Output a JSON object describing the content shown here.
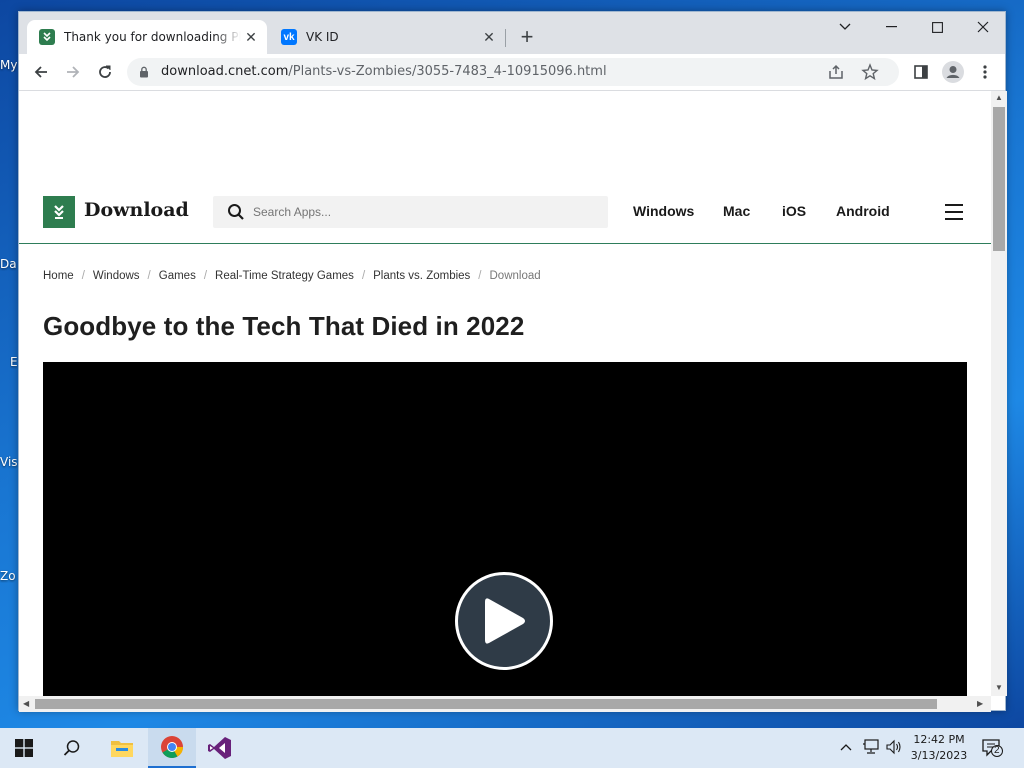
{
  "desktop": {
    "icon_labels": [
      "My",
      "Da",
      "E",
      "Vis",
      "Zo"
    ]
  },
  "browser": {
    "tabs": [
      {
        "title": "Thank you for downloading Plants vs. Zombies",
        "favicon": "download-favicon",
        "active": true
      },
      {
        "title": "VK ID",
        "favicon": "vk-favicon",
        "active": false
      }
    ],
    "url_host": "download.cnet.com",
    "url_path": "/Plants-vs-Zombies/3055-7483_4-10915096.html"
  },
  "site": {
    "logo_text": "Download",
    "search_placeholder": "Search Apps...",
    "nav": [
      "Windows",
      "Mac",
      "iOS",
      "Android"
    ],
    "breadcrumb": [
      "Home",
      "Windows",
      "Games",
      "Real-Time Strategy Games",
      "Plants vs. Zombies",
      "Download"
    ],
    "article_title": "Goodbye to the Tech That Died in 2022"
  },
  "taskbar": {
    "time": "12:42 PM",
    "date": "3/13/2023",
    "notification_count": "2"
  },
  "colors": {
    "brand_green": "#2e7d4f",
    "vk_blue": "#0077ff",
    "taskbar_bg": "#dce8f5"
  }
}
